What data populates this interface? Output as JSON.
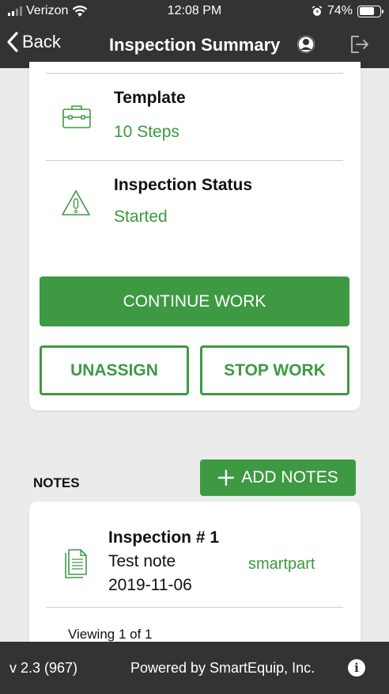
{
  "status_bar": {
    "carrier": "Verizon",
    "time": "12:08 PM",
    "battery": "74%",
    "battery_level": 0.74
  },
  "nav": {
    "back_label": "Back",
    "title": "Inspection Summary",
    "user_icon": "user-circle-icon",
    "logout_icon": "logout-icon"
  },
  "summary": {
    "template_label": "Template",
    "template_value": "10 Steps",
    "status_label": "Inspection Status",
    "status_value": "Started",
    "continue_label": "CONTINUE WORK",
    "unassign_label": "UNASSIGN",
    "stop_label": "STOP WORK"
  },
  "notes": {
    "section_label": "NOTES",
    "add_label": "ADD NOTES",
    "items": [
      {
        "title": "Inspection # 1",
        "text": "Test note",
        "date": "2019-11-06",
        "author": "smartpart"
      }
    ],
    "viewing": "Viewing 1 of 1"
  },
  "footer": {
    "version": "v 2.3 (967)",
    "powered": "Powered by SmartEquip, Inc."
  },
  "colors": {
    "accent": "#3d9a43",
    "bar": "#333333",
    "background": "#ebebeb"
  }
}
